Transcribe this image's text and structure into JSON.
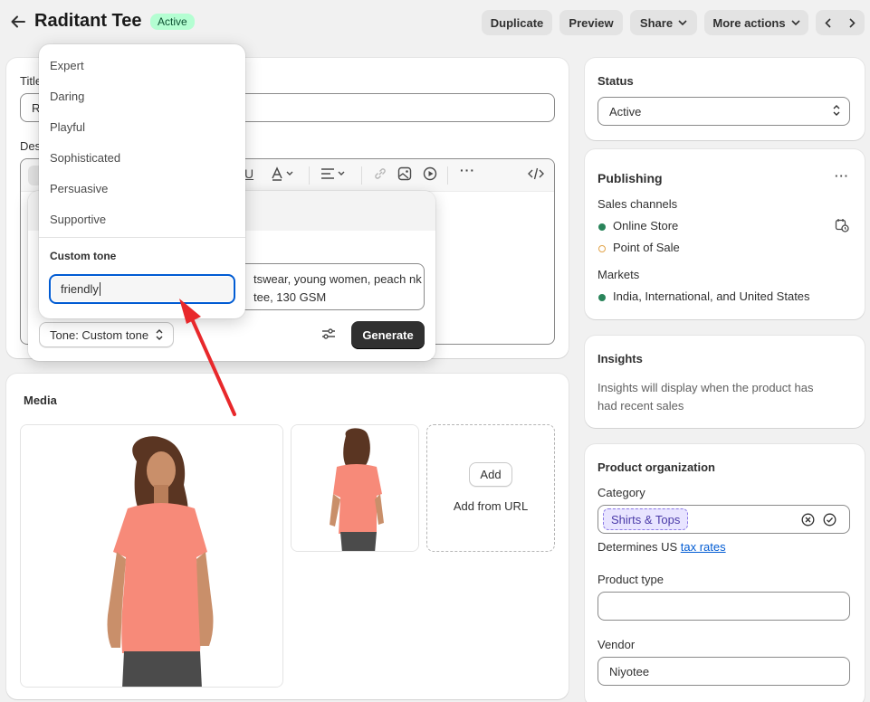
{
  "header": {
    "title": "Raditant Tee",
    "status_badge": "Active",
    "buttons": {
      "duplicate": "Duplicate",
      "preview": "Preview",
      "share": "Share",
      "more_actions": "More actions"
    }
  },
  "product_form": {
    "title_label_visible": "Title",
    "title_value_visible": "R",
    "description_label_visible": "Des"
  },
  "ai_generator": {
    "prompt_text": "tswear, young women, peach nk tee, 130 GSM",
    "tone_button": "Tone: Custom tone",
    "generate_button": "Generate"
  },
  "tone_menu": {
    "items": [
      "Expert",
      "Daring",
      "Playful",
      "Sophisticated",
      "Persuasive",
      "Supportive"
    ],
    "custom_label": "Custom tone",
    "custom_value": "friendly"
  },
  "media": {
    "title": "Media",
    "add_button": "Add",
    "add_from_url": "Add from URL"
  },
  "status_card": {
    "title": "Status",
    "value": "Active"
  },
  "publishing": {
    "title": "Publishing",
    "sales_channels_label": "Sales channels",
    "channels": [
      {
        "name": "Online Store",
        "color": "#29845a"
      },
      {
        "name": "Point of Sale",
        "color": "#e2a44a"
      }
    ],
    "markets_label": "Markets",
    "markets_value": "India, International, and United States"
  },
  "insights": {
    "title": "Insights",
    "text_line1": "Insights will display when the product has",
    "text_line2": "had recent sales"
  },
  "organization": {
    "title": "Product organization",
    "category_label": "Category",
    "category_tag": "Shirts & Tops",
    "determines_prefix": "Determines US ",
    "tax_link": "tax rates",
    "product_type_label": "Product type",
    "product_type_value": "",
    "vendor_label": "Vendor",
    "vendor_value": "Niyotee"
  },
  "colors": {
    "accent_blue": "#005bd3",
    "badge_green_bg": "#b4fed2",
    "annotation_arrow": "#e8282b"
  }
}
